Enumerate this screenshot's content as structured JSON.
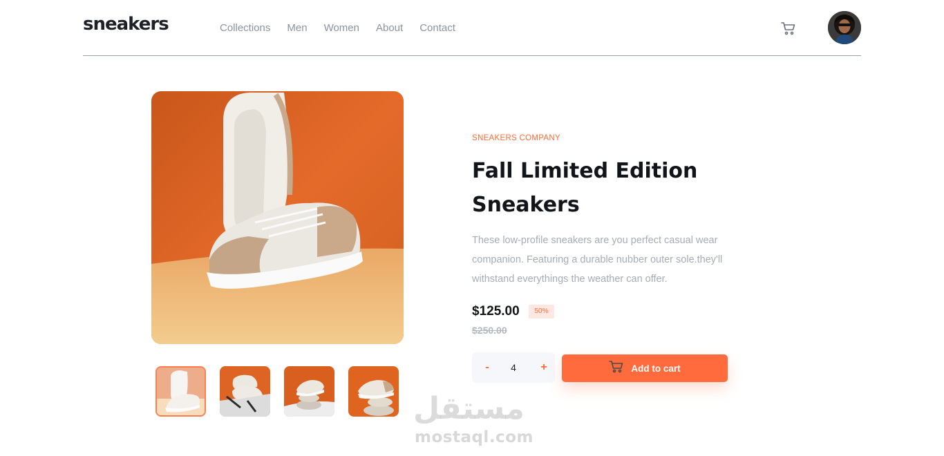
{
  "header": {
    "logo": "sneakers",
    "nav": [
      "Collections",
      "Men",
      "Women",
      "About",
      "Contact"
    ],
    "cart_icon": "cart-icon",
    "avatar_icon": "user-avatar"
  },
  "gallery": {
    "main_image": "sneaker-product-photo",
    "thumbnails": [
      "thumbnail-1",
      "thumbnail-2",
      "thumbnail-3",
      "thumbnail-4"
    ],
    "active_thumbnail": 0
  },
  "product": {
    "company": "SNEAKERS COMPANY",
    "title": "Fall Limited Edition Sneakers",
    "description": "These low-profile sneakers are you perfect casual wear companion. Featuring a durable nubber outer sole.they'll withstand everythings the weather can offer.",
    "price": "$125.00",
    "discount": "50%",
    "old_price": "$250.00"
  },
  "cart_controls": {
    "minus_label": "-",
    "quantity": "4",
    "plus_label": "+",
    "add_label": "Add to cart"
  },
  "colors": {
    "accent": "#ff6b3d",
    "accent_light": "#ffe8e3",
    "text_dark": "#1d2026",
    "text_muted": "#a5acb5"
  },
  "watermark": {
    "arabic": "مستقل",
    "latin": "mostaql.com"
  }
}
